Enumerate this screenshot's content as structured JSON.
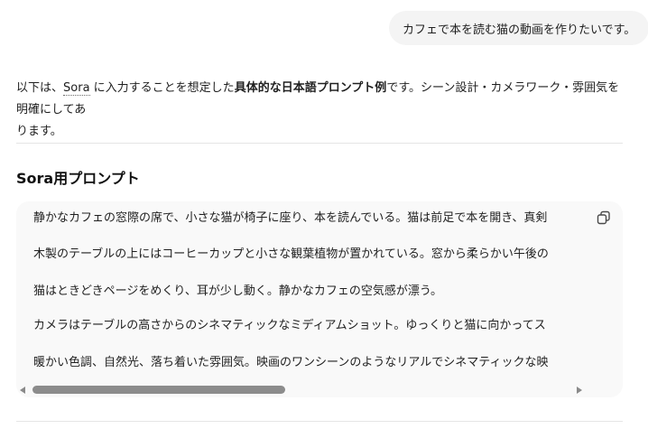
{
  "user_message": "カフェで本を読む猫の動画を作りたいです。",
  "intro": {
    "prefix": "以下は、",
    "sora": "Sora",
    "mid": " に入力することを想定した",
    "bold": "具体的な日本語プロンプト例",
    "suffix_line1": "です。シーン設計・カメラワーク・雰囲気を明確にしてあ",
    "suffix_line2": "ります。"
  },
  "section": {
    "heading": "Sora用プロンプト"
  },
  "code_block": {
    "lines": [
      "静かなカフェの窓際の席で、小さな猫が椅子に座り、本を読んでいる。猫は前足で本を開き、真剣",
      "木製のテーブルの上にはコーヒーカップと小さな観葉植物が置かれている。窓から柔らかい午後の",
      "猫はときどきページをめくり、耳が少し動く。静かなカフェの空気感が漂う。",
      "カメラはテーブルの高さからのシネマティックなミディアムショット。ゆっくりと猫に向かってス",
      "暖かい色調、自然光、落ち着いた雰囲気。映画のワンシーンのようなリアルでシネマティックな映"
    ],
    "scroll_position": 0
  },
  "icons": {
    "copy": "copy-icon",
    "scroll_left": "arrow-left-icon",
    "scroll_right": "arrow-right-icon"
  },
  "colors": {
    "bubble_bg": "#f4f4f4",
    "code_bg": "#f9f9f9",
    "divider": "#e5e5e5",
    "scroll_thumb": "#8c8c8c"
  }
}
